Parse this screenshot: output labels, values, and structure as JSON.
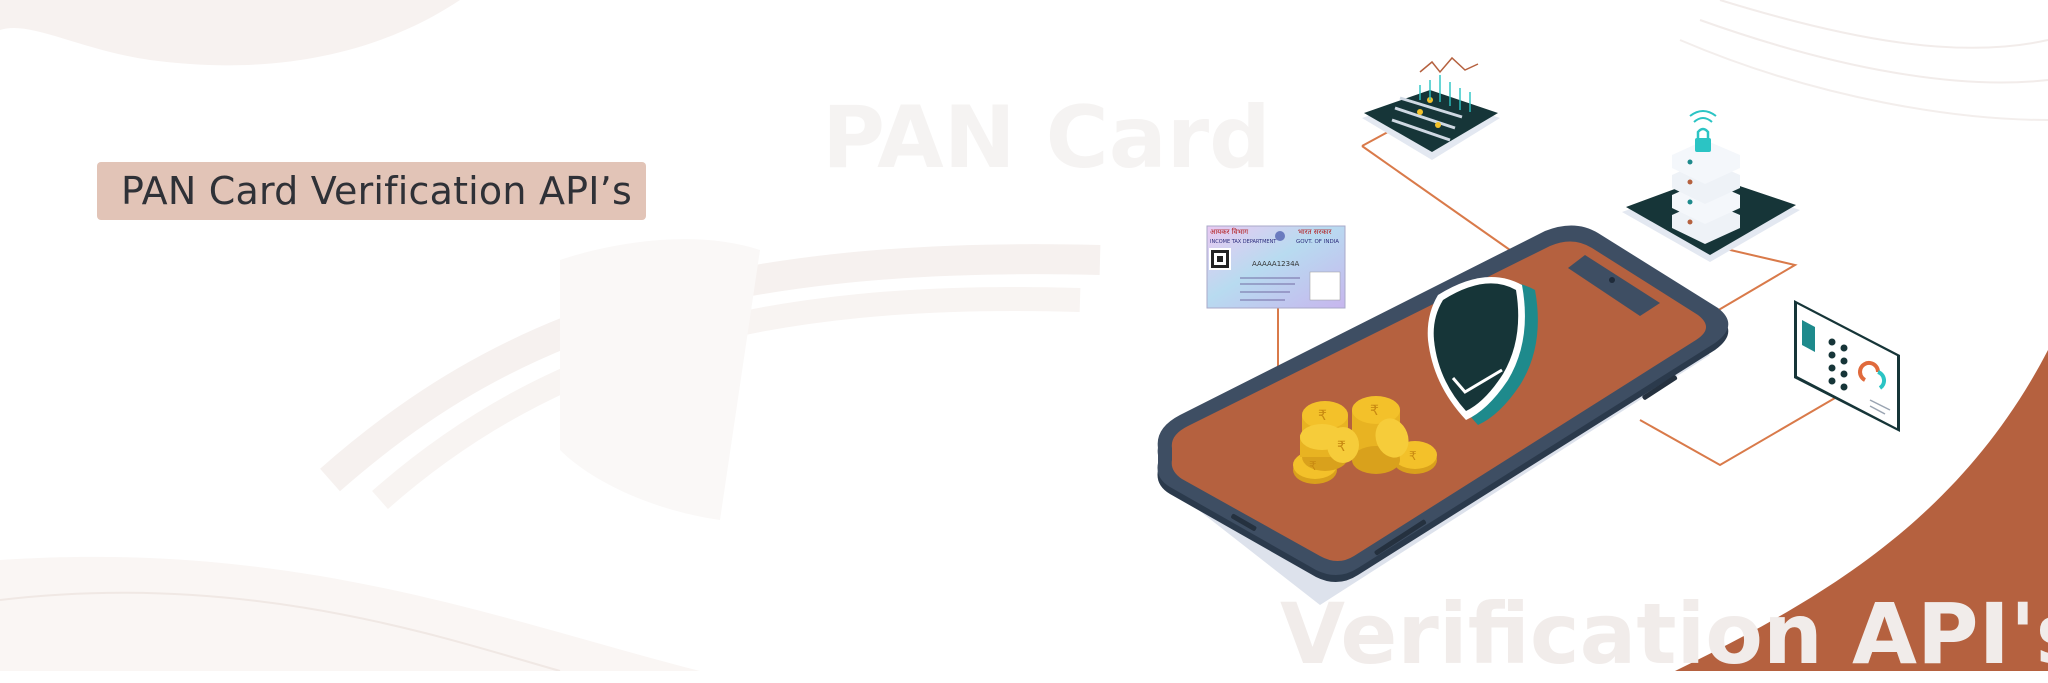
{
  "banner": {
    "heading": "PAN Card Verification API’s",
    "watermark_top": "PAN Card",
    "watermark_bottom": "Verification API's"
  },
  "pan_card": {
    "left_header": "आयकर विभाग",
    "left_subheader": "INCOME TAX DEPARTMENT",
    "right_header": "भारत सरकार",
    "right_subheader": "GOVT. OF INDIA",
    "number": "AAAAA1234A"
  },
  "colors": {
    "accent_copper": "#b5613f",
    "heading_bg": "#e2c4b7",
    "dark_teal": "#143437",
    "phone_frame": "#3b4b5e",
    "coin_gold": "#f3c12a",
    "line_orange": "#d97a4a"
  }
}
